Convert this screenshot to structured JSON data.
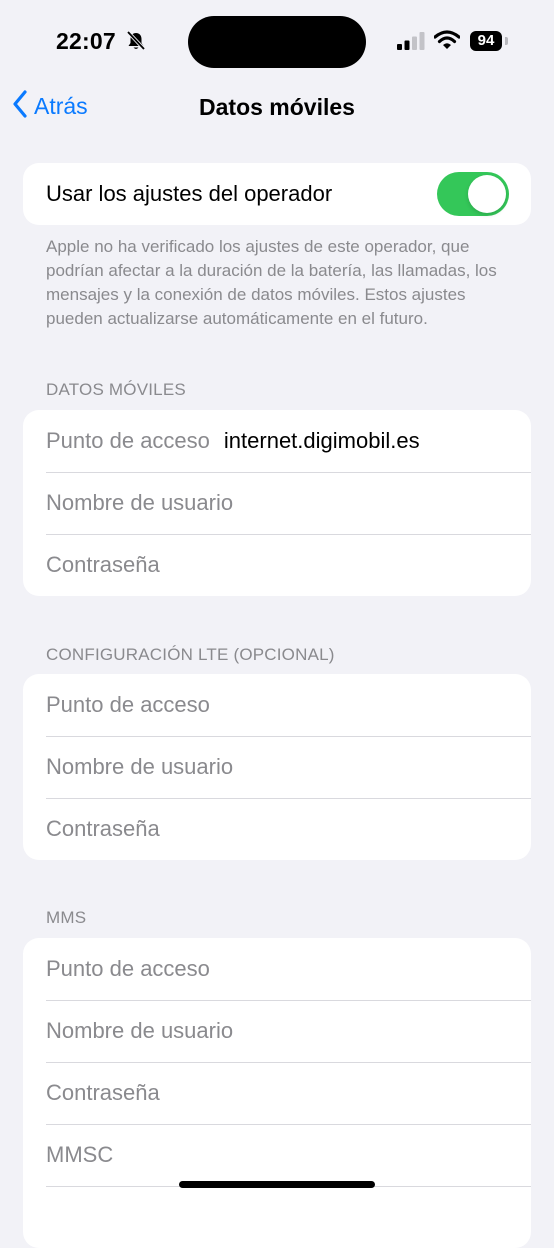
{
  "status_bar": {
    "time": "22:07",
    "battery": "94",
    "icons": [
      "bell-slash-icon",
      "signal-icon",
      "wifi-icon",
      "battery-icon"
    ]
  },
  "nav": {
    "back_label": "Atrás",
    "title": "Datos móviles"
  },
  "carrier_settings": {
    "label": "Usar los ajustes del operador",
    "enabled": true,
    "footnote": "Apple no ha verificado los ajustes de este operador, que podrían afectar a la duración de la batería, las llamadas, los mensajes y la conexión de datos móviles. Estos ajustes pueden actualizarse automáticamente en el futuro."
  },
  "mobile_data": {
    "header": "DATOS MÓVILES",
    "rows": [
      {
        "label": "Punto de acceso",
        "value": "internet.digimobil.es"
      },
      {
        "label": "Nombre de usuario",
        "value": ""
      },
      {
        "label": "Contraseña",
        "value": ""
      }
    ]
  },
  "lte": {
    "header": "CONFIGURACIÓN LTE (OPCIONAL)",
    "rows": [
      {
        "label": "Punto de acceso"
      },
      {
        "label": "Nombre de usuario"
      },
      {
        "label": "Contraseña"
      }
    ]
  },
  "mms": {
    "header": "MMS",
    "rows": [
      {
        "label": "Punto de acceso"
      },
      {
        "label": "Nombre de usuario"
      },
      {
        "label": "Contraseña"
      },
      {
        "label": "MMSC"
      }
    ]
  },
  "colors": {
    "accent": "#0a7aff",
    "toggle_on": "#34c759",
    "background": "#f2f2f7",
    "secondary_text": "#8a8a8e"
  }
}
